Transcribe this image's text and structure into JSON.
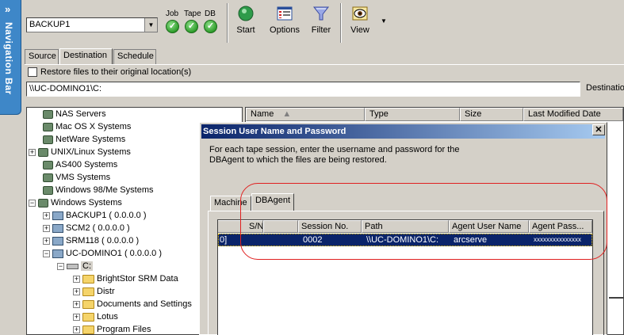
{
  "nav": {
    "label": "Navigation Bar"
  },
  "toolbar": {
    "server": "BACKUP1",
    "status_labels": [
      "Job",
      "Tape",
      "DB"
    ],
    "buttons": {
      "start": "Start",
      "options": "Options",
      "filter": "Filter",
      "view": "View"
    }
  },
  "tabs": [
    "Source",
    "Destination",
    "Schedule"
  ],
  "restore_option": "Restore files to their original location(s)",
  "dest_path": "\\\\UC-DOMINO1\\C:",
  "dest_label": "Destinatio",
  "tree": [
    "NAS Servers",
    "Mac OS X Systems",
    "NetWare Systems",
    "UNIX/Linux Systems",
    "AS400 Systems",
    "VMS Systems",
    "Windows 98/Me Systems",
    "Windows Systems",
    "BACKUP1 ( 0.0.0.0 )",
    "SCM2 ( 0.0.0.0 )",
    "SRM118 ( 0.0.0.0 )",
    "UC-DOMINO1 ( 0.0.0.0 )",
    "C:",
    "BrightStor SRM Data",
    "Distr",
    "Documents and Settings",
    "Lotus",
    "Program Files"
  ],
  "list_columns": [
    "Name",
    "Type",
    "Size",
    "Last Modified Date"
  ],
  "dialog": {
    "title": "Session User Name and Password",
    "message": "For each tape session, enter the username and password for the DBAgent to which the files are being restored.",
    "tabs": [
      "Machine",
      "DBAgent"
    ],
    "columns": [
      "S/N",
      "Session No.",
      "Path",
      "Agent User Name",
      "Agent Pass..."
    ],
    "row": {
      "sn_fragment": "0]",
      "session": "0002",
      "path": "\\\\UC-DOMINO1\\C:",
      "user": "arcserve",
      "password": "xxxxxxxxxxxxxxx"
    }
  },
  "colors": {
    "nav_blue": "#3e87c8",
    "title_blue": "#0a246a",
    "annotation_red": "#e02020"
  }
}
